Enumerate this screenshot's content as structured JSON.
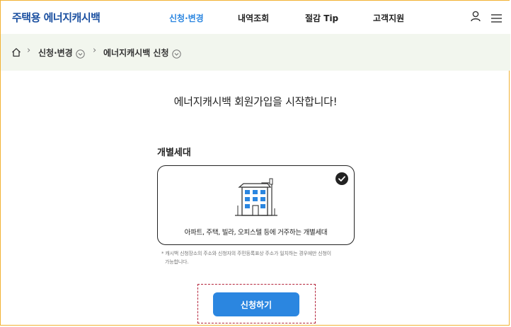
{
  "header": {
    "logo": "주택용 에너지캐시백",
    "nav": [
      {
        "label": "신청·변경",
        "active": true
      },
      {
        "label": "내역조회",
        "active": false
      },
      {
        "label": "절감 Tip",
        "active": false
      },
      {
        "label": "고객지원",
        "active": false
      }
    ],
    "icons": [
      "user-icon",
      "menu-icon"
    ]
  },
  "breadcrumb": {
    "home_icon": "home-icon",
    "items": [
      "신청·변경",
      "에너지캐시백 신청"
    ]
  },
  "main": {
    "headline": "에너지캐시백 회원가입을 시작합니다!",
    "section_title": "개별세대",
    "card": {
      "icon": "apartment-building-icon",
      "description": "아파트, 주택, 빌라, 오피스텔 등에 거주하는 개별세대",
      "selected": true
    },
    "note_line1": "* 캐시백 신청장소의 주소와 신청자의 주민등록표상 주소가 일치하는 경우에만 신청이",
    "note_line2": "가능합니다.",
    "apply_button": "신청하기"
  },
  "colors": {
    "accent": "#2b86e0",
    "logo": "#1a4fa0",
    "breadcrumb_bg": "#f2f6ee",
    "highlight_dash": "#b4233a",
    "frame": "#f2b233"
  }
}
